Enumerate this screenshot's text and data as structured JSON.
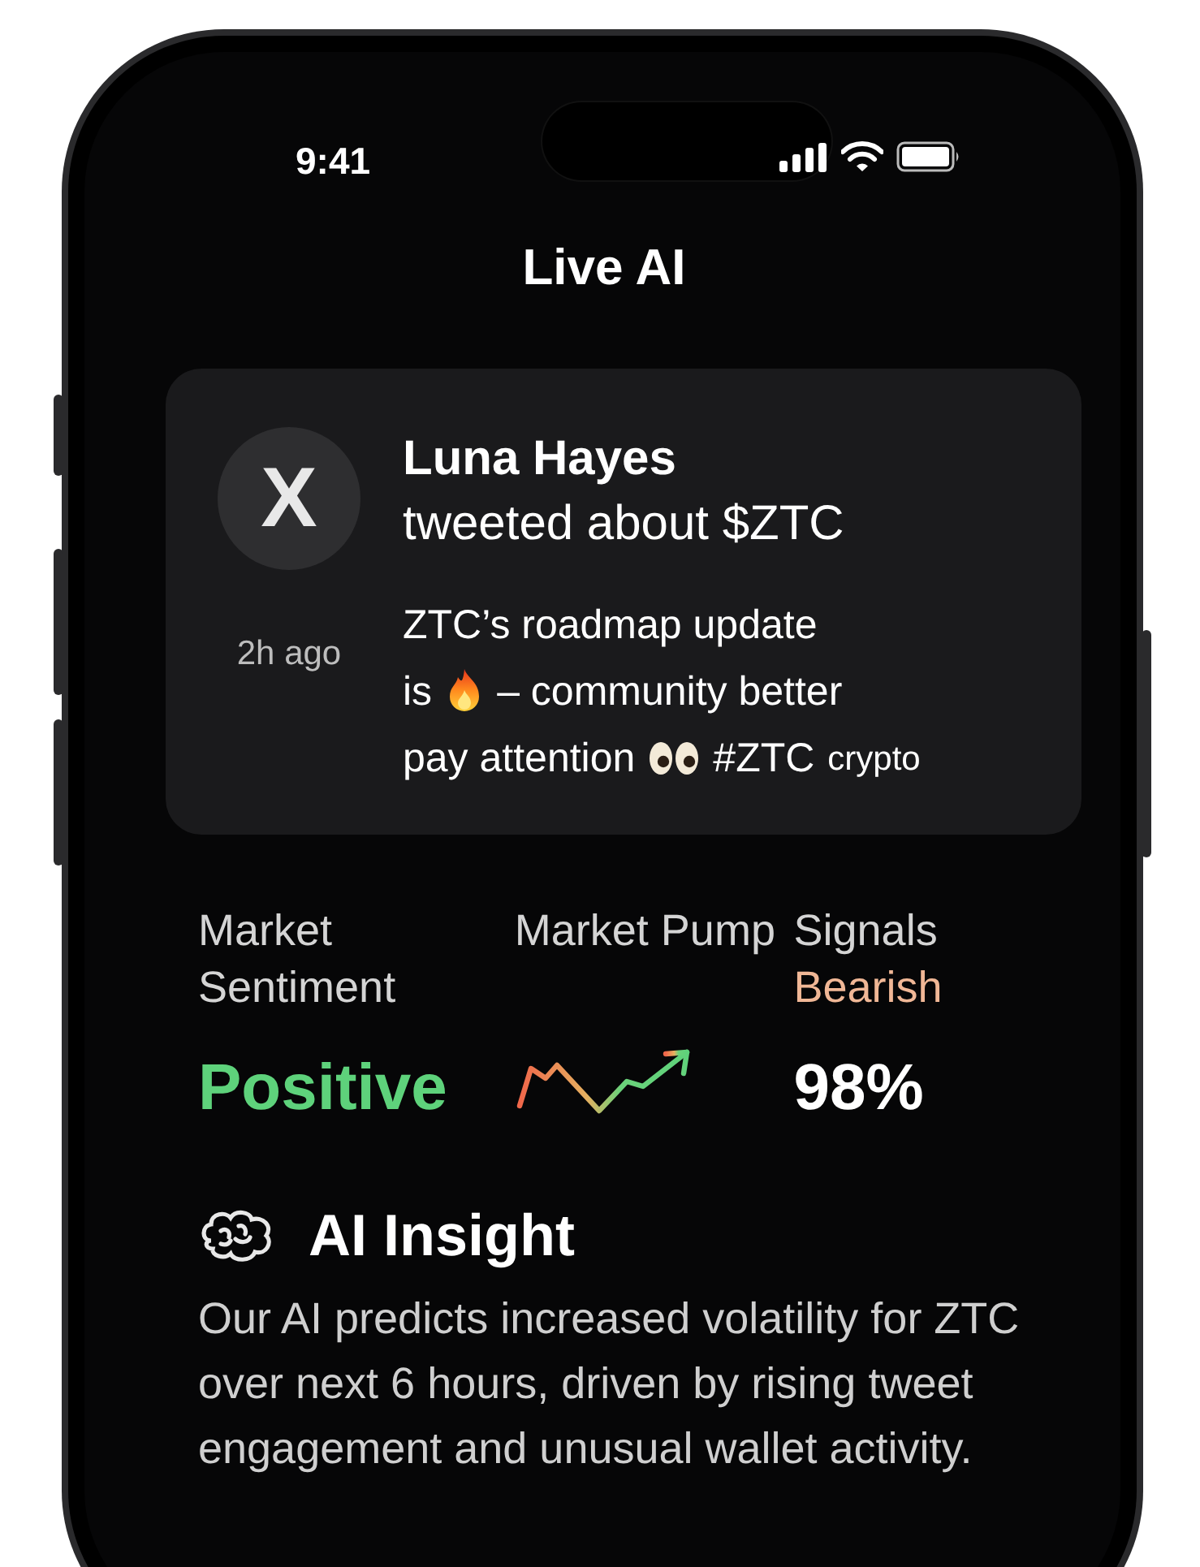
{
  "status_bar": {
    "time": "9:41"
  },
  "title": "Live AI",
  "tweet_card": {
    "avatar_letter": "X",
    "age": "2h ago",
    "author": "Luna Hayes",
    "headline": "tweeted about $ZTC",
    "body": [
      [
        {
          "kind": "text",
          "text": "ZTC’s roadmap update"
        }
      ],
      [
        {
          "kind": "text",
          "text": "is"
        },
        {
          "kind": "fire"
        },
        {
          "kind": "text",
          "text": "– community better"
        }
      ],
      [
        {
          "kind": "text",
          "text": "pay attention"
        },
        {
          "kind": "eyes"
        },
        {
          "kind": "text",
          "text": "#ZTC"
        },
        {
          "kind": "small",
          "text": "crypto"
        }
      ]
    ]
  },
  "stats": [
    {
      "kind": "sentiment",
      "label": "Market Sentiment",
      "value": "Positive"
    },
    {
      "kind": "sparkline",
      "label": "Market Pump"
    },
    {
      "kind": "percent",
      "label": "Signals",
      "sublabel": "Bearish",
      "value": "98%"
    }
  ],
  "insight": {
    "title": "AI Insight",
    "text": "Our AI predicts increased volatility for ZTC over next 6 hours, driven by rising tweet engagement and unusual wallet activity."
  }
}
